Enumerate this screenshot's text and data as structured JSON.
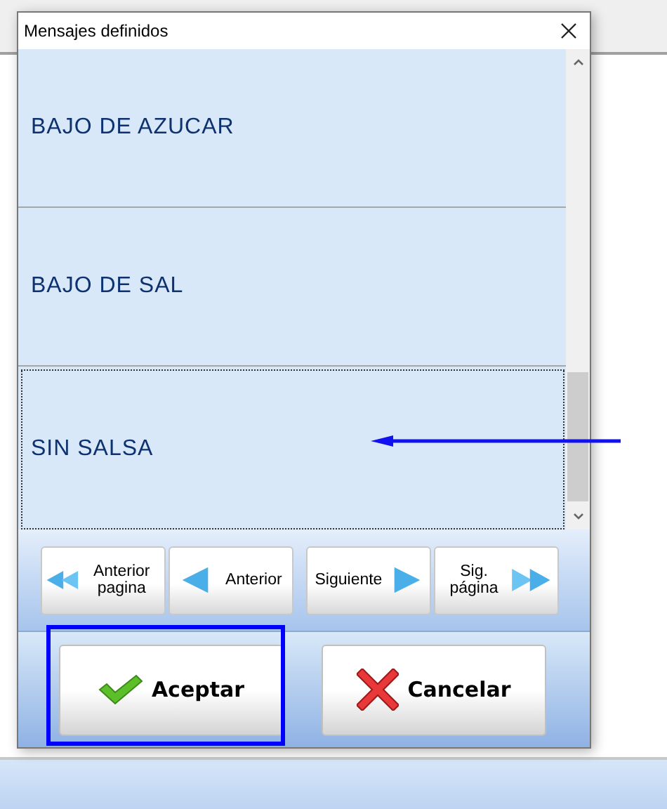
{
  "window": {
    "title": "Mensajes definidos"
  },
  "messages": [
    {
      "text": "BAJO DE AZUCAR",
      "selected": false
    },
    {
      "text": "BAJO DE SAL",
      "selected": false
    },
    {
      "text": "SIN SALSA",
      "selected": true
    }
  ],
  "nav_buttons": [
    {
      "kind": "first",
      "label": "Anterior pagina"
    },
    {
      "kind": "prev",
      "label": "Anterior"
    },
    {
      "kind": "next",
      "label": "Siguiente"
    },
    {
      "kind": "last",
      "label": "Sig. página"
    }
  ],
  "buttons": [
    {
      "kind": "ok",
      "label": "Aceptar",
      "highlighted": true
    },
    {
      "kind": "cancel",
      "label": "Cancelar",
      "highlighted": false
    }
  ]
}
